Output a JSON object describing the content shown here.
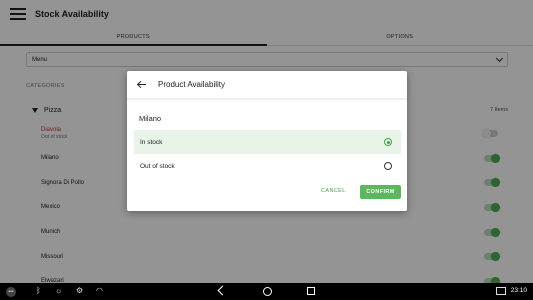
{
  "app": {
    "title": "Stock Availability",
    "tabs": [
      {
        "label": "PRODUCTS",
        "active": true
      },
      {
        "label": "OPTIONS",
        "active": false
      }
    ],
    "menu_select": "Menu",
    "categories_label": "CATEGORIES",
    "group": {
      "name": "Pizza",
      "count": "7 Items"
    },
    "items": [
      {
        "name": "Diavola",
        "status": "Out of stock",
        "in_stock": false
      },
      {
        "name": "Milano",
        "status": "",
        "in_stock": true
      },
      {
        "name": "Signora Di Pollo",
        "status": "",
        "in_stock": true
      },
      {
        "name": "Mexico",
        "status": "",
        "in_stock": true
      },
      {
        "name": "Munich",
        "status": "",
        "in_stock": true
      },
      {
        "name": "Missouri",
        "status": "",
        "in_stock": true
      },
      {
        "name": "Elwazari",
        "status": "",
        "in_stock": true
      }
    ]
  },
  "dialog": {
    "title": "Product Availability",
    "product": "Milano",
    "options": [
      {
        "label": "In stock",
        "selected": true
      },
      {
        "label": "Out of stock",
        "selected": false
      }
    ],
    "cancel_label": "CANCEL",
    "confirm_label": "CONFIRM"
  },
  "system_bar": {
    "clock": "23:10",
    "icons": [
      "more-icon",
      "bluetooth-icon",
      "brightness-icon",
      "settings-icon",
      "wifi-icon",
      "back-icon",
      "home-icon",
      "recents-icon",
      "screenshot-icon"
    ]
  },
  "colors": {
    "accent": "#43a047",
    "confirm_bg": "#5cb85c",
    "selected_bg": "#e9f4e8",
    "out_of_stock": "#d32f2f"
  }
}
